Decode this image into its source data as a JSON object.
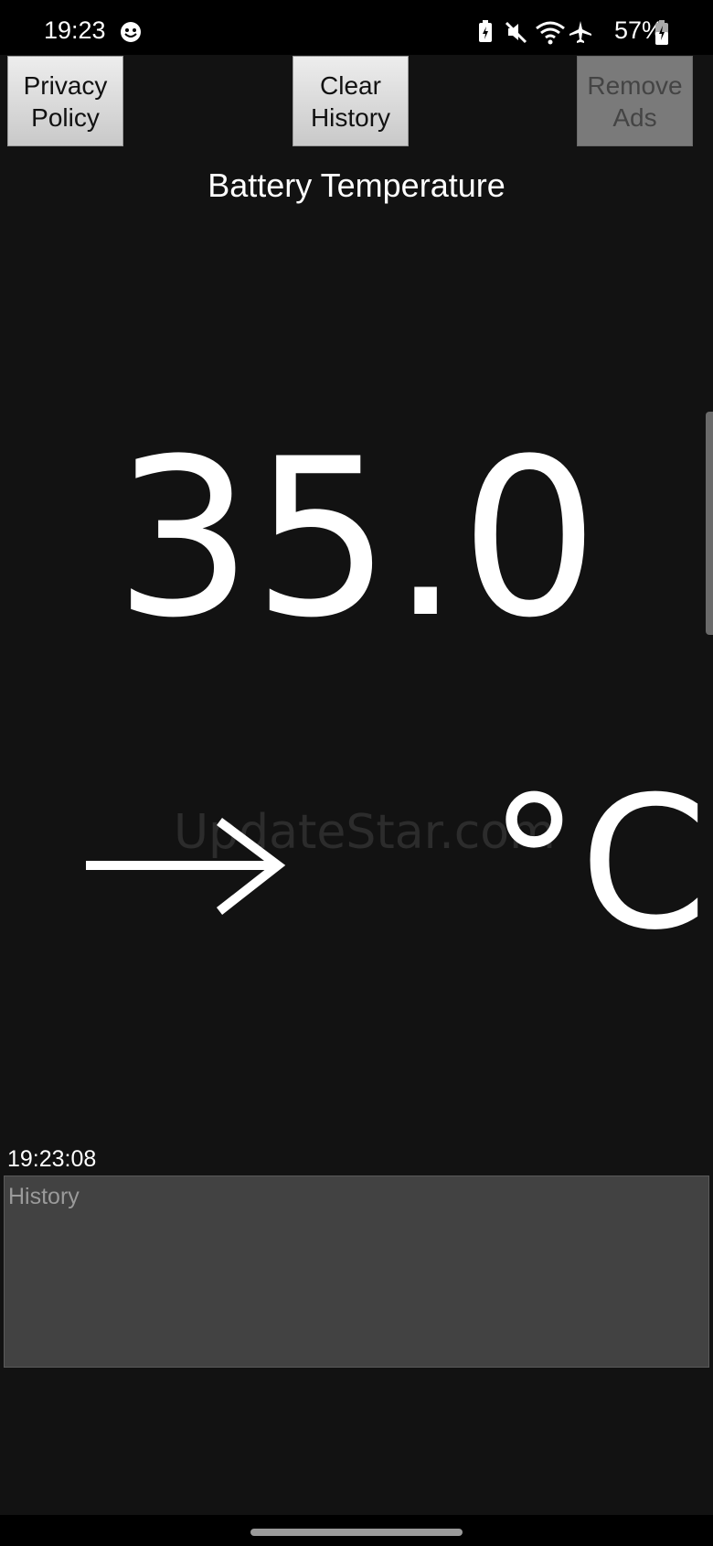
{
  "status_bar": {
    "time": "19:23",
    "battery_percent": "57%",
    "icons": [
      "smiley-icon",
      "battery-saver-icon",
      "mute-icon",
      "wifi-icon",
      "airplane-icon",
      "battery-icon"
    ]
  },
  "toolbar": {
    "privacy_label": "Privacy\nPolicy",
    "clear_label": "Clear\nHistory",
    "remove_ads_label": "Remove\nAds"
  },
  "main": {
    "title": "Battery Temperature",
    "temperature": "35.0",
    "unit": "°C",
    "trend_icon": "arrow-right-icon",
    "watermark": "UpdateStar.com"
  },
  "history": {
    "timestamp": "19:23:08",
    "placeholder": "History"
  },
  "colors": {
    "background": "#121212",
    "text": "#ffffff",
    "button": "#d9d9d9",
    "history_box": "#424242"
  }
}
